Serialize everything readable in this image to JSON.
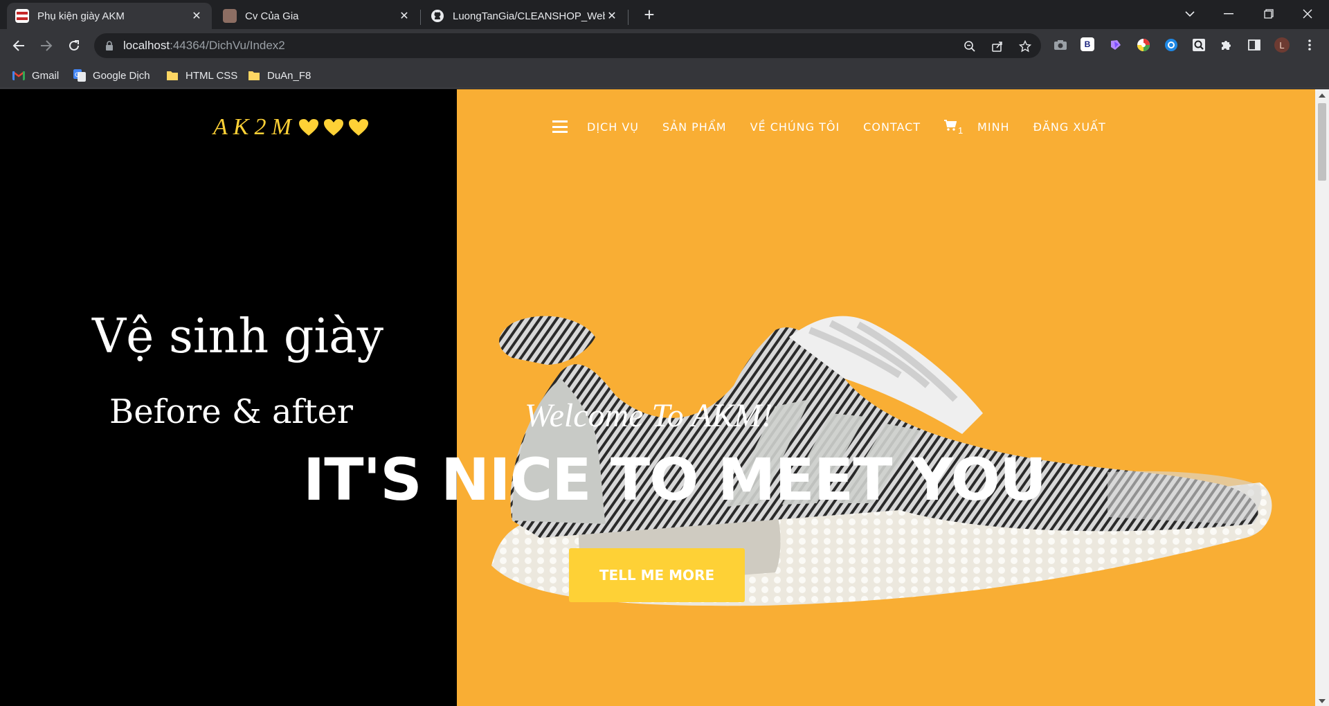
{
  "browser": {
    "tabs": [
      {
        "title": "Phụ kiện giày AKM",
        "active": true
      },
      {
        "title": "Cv Của Gia",
        "active": false
      },
      {
        "title": "LuongTanGia/CLEANSHOP_Web",
        "active": false
      }
    ],
    "url_host": "localhost",
    "url_rest": ":44364/DichVu/Index2",
    "bookmarks": [
      "Gmail",
      "Google Dịch",
      "HTML CSS",
      "DuAn_F8"
    ],
    "profile_initial": "L",
    "extension_b_label": "B"
  },
  "page": {
    "colors": {
      "accent": "#fed136",
      "orange": "#f9ae34",
      "left_bg": "#000000"
    },
    "logo_text": "AK2M",
    "nav": {
      "items": [
        "DỊCH VỤ",
        "SẢN PHẨM",
        "VỀ CHÚNG TÔI",
        "CONTACT"
      ],
      "cart_count": "1",
      "user": "MINH",
      "logout": "ĐĂNG XUẤT"
    },
    "left_heading": "Vệ sinh giày",
    "left_subheading": "Before & after",
    "welcome": "Welcome To AKM!",
    "hero_title": "IT'S NICE TO MEET YOU",
    "cta_label": "TELL ME MORE"
  }
}
